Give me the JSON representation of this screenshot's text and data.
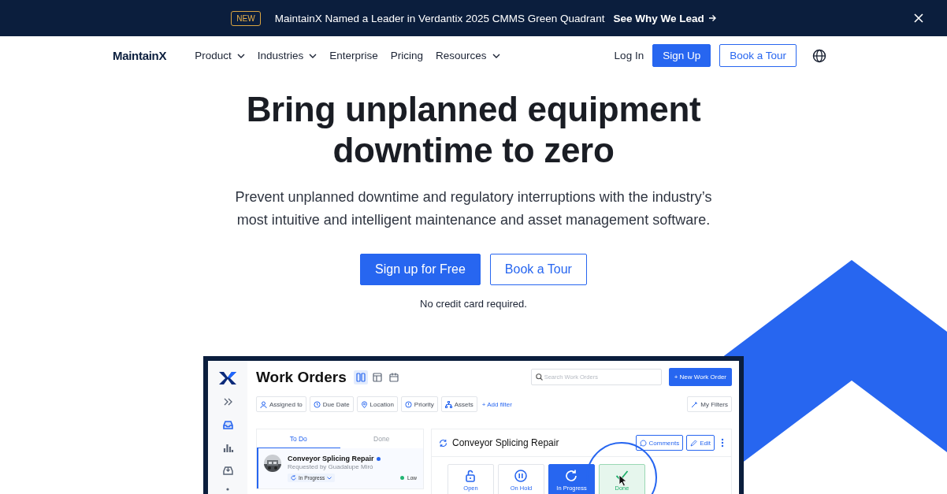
{
  "announcement": {
    "badge": "NEW",
    "text": "MaintainX Named a Leader in Verdantix 2025 CMMS Green Quadrant",
    "link": "See Why We Lead"
  },
  "nav": {
    "logo": "MaintainX",
    "items": [
      {
        "label": "Product",
        "kind": "dropdown"
      },
      {
        "label": "Industries",
        "kind": "dropdown"
      },
      {
        "label": "Enterprise",
        "kind": "link"
      },
      {
        "label": "Pricing",
        "kind": "link"
      },
      {
        "label": "Resources",
        "kind": "dropdown"
      }
    ],
    "login": "Log In",
    "signup": "Sign Up",
    "tour": "Book a Tour"
  },
  "hero": {
    "title": [
      "Bring unplanned equipment",
      "downtime to zero"
    ],
    "subtitle": [
      "Prevent unplanned downtime and regulatory interruptions with the industry’s",
      "most intuitive and intelligent maintenance and asset management software."
    ],
    "primary": "Sign up for Free",
    "secondary": "Book a Tour",
    "note": "No credit card required."
  },
  "app": {
    "sidebar_items": [
      {
        "selected": false
      },
      {
        "selected": true
      },
      {
        "selected": false
      },
      {
        "selected": false
      }
    ],
    "title": "Work Orders",
    "views": [
      {
        "selected": true
      },
      {
        "selected": false
      },
      {
        "selected": false
      }
    ],
    "search": {
      "placeholder": "Search Work Orders"
    },
    "new_button": "+ New Work Order",
    "filters": [
      "Assigned to",
      "Due Date",
      "Location",
      "Priority",
      "Assets"
    ],
    "add_filter": "+ Add filter",
    "my_filters": "My Filters",
    "tabs": [
      {
        "label": "To Do",
        "selected": true
      },
      {
        "label": "Done",
        "selected": false
      }
    ],
    "work_order": {
      "title": "Conveyor Splicing Repair",
      "requester": "Requested by Guadalupe Miró",
      "status": "In Progress",
      "priority": "Low",
      "unread": true
    },
    "detail": {
      "title": "Conveyor Splicing Repair",
      "comments": "Comments",
      "edit": "Edit",
      "statuses": [
        {
          "label": "Open",
          "kind": "open",
          "selected": false,
          "highlighted": false
        },
        {
          "label": "On Hold",
          "kind": "hold",
          "selected": false,
          "highlighted": false
        },
        {
          "label": "In Progress",
          "kind": "progress",
          "selected": true,
          "highlighted": false
        },
        {
          "label": "Done",
          "kind": "done",
          "selected": false,
          "highlighted": true
        }
      ]
    }
  }
}
